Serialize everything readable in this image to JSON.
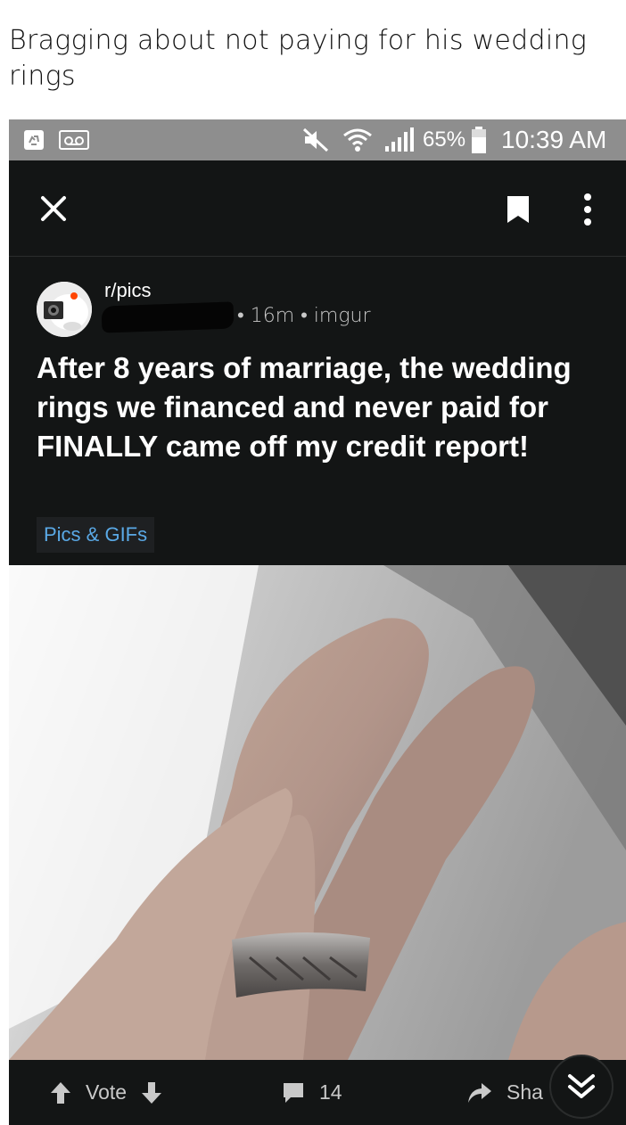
{
  "caption": "Bragging about not paying for his wedding rings",
  "status_bar": {
    "battery": "65%",
    "time": "10:39 AM",
    "icons": [
      "recycle-icon",
      "voicemail-icon",
      "mute-icon",
      "wifi-icon",
      "signal-icon",
      "battery-icon"
    ]
  },
  "toolbar": {
    "icons": [
      "close-icon",
      "bookmark-icon",
      "more-vertical-icon"
    ]
  },
  "post": {
    "subreddit": "r/pics",
    "meta": "• 16m • imgur",
    "title": "After 8 years of marriage, the wedding rings we financed and never paid for FINALLY came off my credit report!",
    "flair": "Pics & GIFs",
    "flair_color": "#5aa9e6"
  },
  "actions": {
    "vote_label": "Vote",
    "comments_count": "14",
    "share_label": "Sha"
  }
}
